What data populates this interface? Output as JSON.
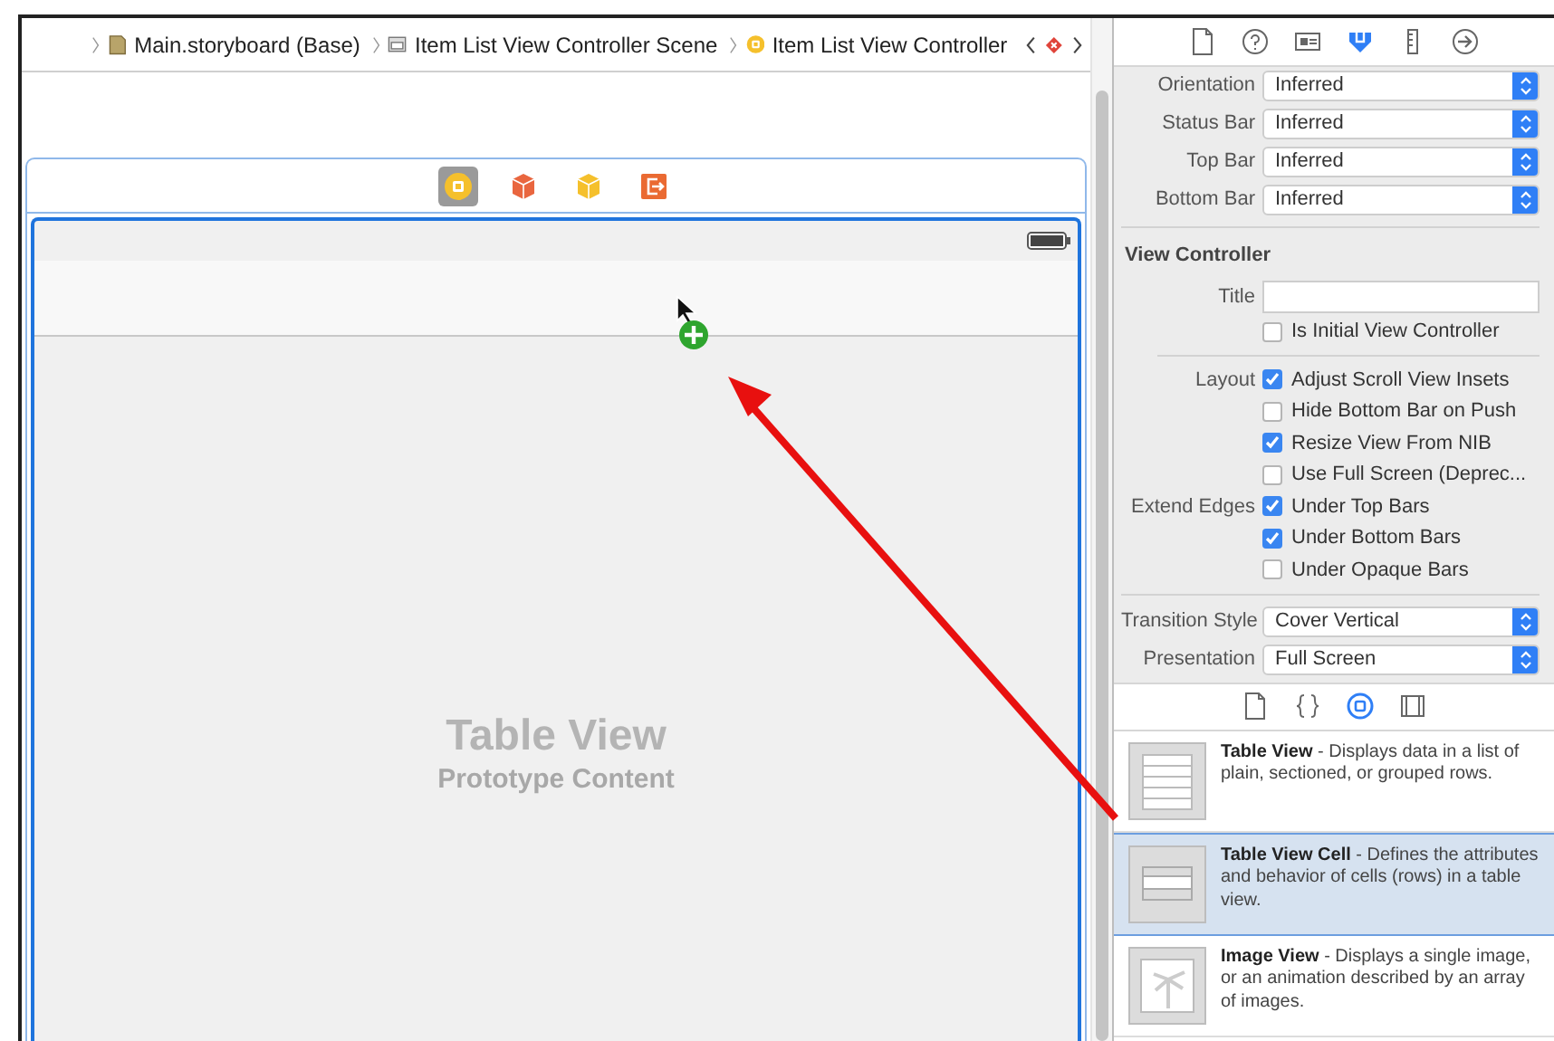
{
  "breadcrumb": [
    {
      "label": "Main.storyboard (Base)",
      "kind": "storyboard"
    },
    {
      "label": "Item List View Controller Scene",
      "kind": "scene"
    },
    {
      "label": "Item List View Controller",
      "kind": "controller"
    }
  ],
  "scene_dock": [
    {
      "kind": "controller",
      "selected": true
    },
    {
      "kind": "first-responder",
      "selected": false
    },
    {
      "kind": "object",
      "selected": false
    },
    {
      "kind": "exit",
      "selected": false
    }
  ],
  "canvas": {
    "title": "Table View",
    "subtitle": "Prototype Content"
  },
  "inspector": {
    "tabs": [
      {
        "kind": "file",
        "selected": false
      },
      {
        "kind": "help",
        "selected": false
      },
      {
        "kind": "identity",
        "selected": false
      },
      {
        "kind": "attributes",
        "selected": true
      },
      {
        "kind": "size",
        "selected": false
      },
      {
        "kind": "connections",
        "selected": false
      }
    ],
    "metrics": [
      {
        "label": "Orientation",
        "value": "Inferred"
      },
      {
        "label": "Status Bar",
        "value": "Inferred"
      },
      {
        "label": "Top Bar",
        "value": "Inferred"
      },
      {
        "label": "Bottom Bar",
        "value": "Inferred"
      }
    ],
    "section": "View Controller",
    "title_field": {
      "label": "Title"
    },
    "initial": {
      "label": "Is Initial View Controller",
      "checked": false
    },
    "groups": [
      {
        "label": "Layout",
        "options": [
          {
            "label": "Adjust Scroll View Insets",
            "checked": true
          },
          {
            "label": "Hide Bottom Bar on Push",
            "checked": false
          },
          {
            "label": "Resize View From NIB",
            "checked": true
          },
          {
            "label": "Use Full Screen (Deprec...",
            "checked": false
          }
        ]
      },
      {
        "label": "Extend Edges",
        "options": [
          {
            "label": "Under Top Bars",
            "checked": true
          },
          {
            "label": "Under Bottom Bars",
            "checked": true
          },
          {
            "label": "Under Opaque Bars",
            "checked": false
          }
        ]
      }
    ],
    "transition": [
      {
        "label": "Transition Style",
        "value": "Cover Vertical"
      },
      {
        "label": "Presentation",
        "value": "Full Screen"
      }
    ]
  },
  "library": {
    "tabs": [
      {
        "kind": "file",
        "selected": false
      },
      {
        "kind": "code",
        "selected": false
      },
      {
        "kind": "object",
        "selected": true
      },
      {
        "kind": "media",
        "selected": false
      }
    ],
    "items": [
      {
        "kind": "table",
        "text": "**Table View** - Displays data in a list of plain, sectioned, or grouped rows.",
        "selected": false
      },
      {
        "kind": "cell",
        "text": "**Table View Cell** - Defines the attributes and behavior of cells (rows) in a table view.",
        "selected": true
      },
      {
        "kind": "image",
        "text": "**Image View** - Displays a single image, or an animation described by an array of images.",
        "selected": false
      }
    ]
  }
}
